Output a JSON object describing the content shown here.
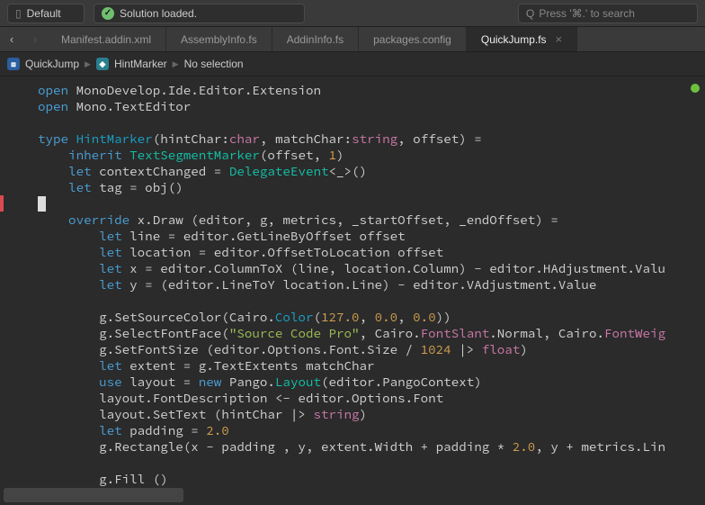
{
  "toolbar": {
    "config_label": "Default",
    "status_text": "Solution loaded.",
    "search_placeholder": "Press '⌘.' to search"
  },
  "tabs": [
    {
      "label": "Manifest.addin.xml",
      "active": false
    },
    {
      "label": "AssemblyInfo.fs",
      "active": false
    },
    {
      "label": "AddinInfo.fs",
      "active": false
    },
    {
      "label": "packages.config",
      "active": false
    },
    {
      "label": "QuickJump.fs",
      "active": true
    }
  ],
  "breadcrumb": {
    "item1": "QuickJump",
    "item2": "HintMarker",
    "item3": "No selection"
  },
  "code": {
    "l0a": "open",
    "l0b": " MonoDevelop.Ide.Editor.Extension",
    "l1a": "open",
    "l1b": " Mono.TextEditor",
    "l3a": "type",
    "l3b": " ",
    "l3c": "HintMarker",
    "l3d": "(hintChar:",
    "l3e": "char",
    "l3f": ", matchChar:",
    "l3g": "string",
    "l3h": ", offset) =",
    "l4a": "    inherit",
    "l4b": " ",
    "l4c": "TextSegmentMarker",
    "l4d": "(offset, ",
    "l4e": "1",
    "l4f": ")",
    "l5a": "    let",
    "l5b": " contextChanged = ",
    "l5c": "DelegateEvent",
    "l5d": "<_>()",
    "l6a": "    let",
    "l6b": " tag = obj()",
    "l8a": "    override",
    "l8b": " x.Draw (editor, g, metrics, _startOffset, _endOffset) =",
    "l9a": "        let",
    "l9b": " line = editor.GetLineByOffset offset",
    "l10a": "        let",
    "l10b": " location = editor.OffsetToLocation offset",
    "l11a": "        let",
    "l11b": " x = editor.ColumnToX (line, location.Column) - editor.HAdjustment.Valu",
    "l12a": "        let",
    "l12b": " y = (editor.LineToY location.Line) - editor.VAdjustment.Value",
    "l14": "        g.SetSourceColor(Cairo.",
    "l14b": "Color",
    "l14c": "(",
    "l14d": "127.0",
    "l14e": ", ",
    "l14f": "0.0",
    "l14g": ", ",
    "l14h": "0.0",
    "l14i": "))",
    "l15": "        g.SelectFontFace(",
    "l15b": "\"Source Code Pro\"",
    "l15c": ", Cairo.",
    "l15d": "FontSlant",
    "l15e": ".Normal, Cairo.",
    "l15f": "FontWeig",
    "l16": "        g.SetFontSize (editor.Options.Font.Size / ",
    "l16b": "1024",
    "l16c": " |> ",
    "l16d": "float",
    "l16e": ")",
    "l17a": "        let",
    "l17b": " extent = g.TextExtents matchChar",
    "l18a": "        use",
    "l18b": " layout = ",
    "l18c": "new",
    "l18d": " Pango.",
    "l18e": "Layout",
    "l18f": "(editor.PangoContext)",
    "l19": "        layout.FontDescription <- editor.Options.Font",
    "l20": "        layout.SetText (hintChar |> ",
    "l20b": "string",
    "l20c": ")",
    "l21a": "        let",
    "l21b": " padding = ",
    "l21c": "2.0",
    "l22": "        g.Rectangle(x - padding , y, extent.Width + padding * ",
    "l22b": "2.0",
    "l22c": ", y + metrics.Lin",
    "l24": "        g.Fill ()"
  }
}
